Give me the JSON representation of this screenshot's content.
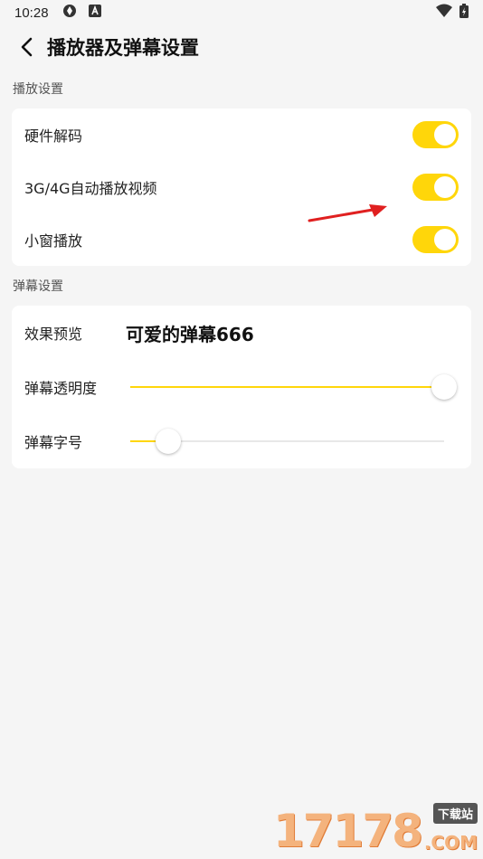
{
  "status_bar": {
    "time": "10:28"
  },
  "app_bar": {
    "title": "播放器及弹幕设置"
  },
  "playback": {
    "section_title": "播放设置",
    "items": [
      {
        "label": "硬件解码",
        "enabled": true
      },
      {
        "label": "3G/4G自动播放视频",
        "enabled": true
      },
      {
        "label": "小窗播放",
        "enabled": true
      }
    ]
  },
  "danmaku": {
    "section_title": "弹幕设置",
    "preview_label": "效果预览",
    "preview_text": "可爱的弹幕666",
    "opacity_label": "弹幕透明度",
    "opacity_value": 1.0,
    "font_size_label": "弹幕字号",
    "font_size_value": 0.12
  },
  "colors": {
    "accent": "#ffd60a",
    "arrow": "#e02020"
  },
  "watermark": {
    "digits": "17178",
    "badge": "下载站",
    "suffix": ".COM"
  }
}
